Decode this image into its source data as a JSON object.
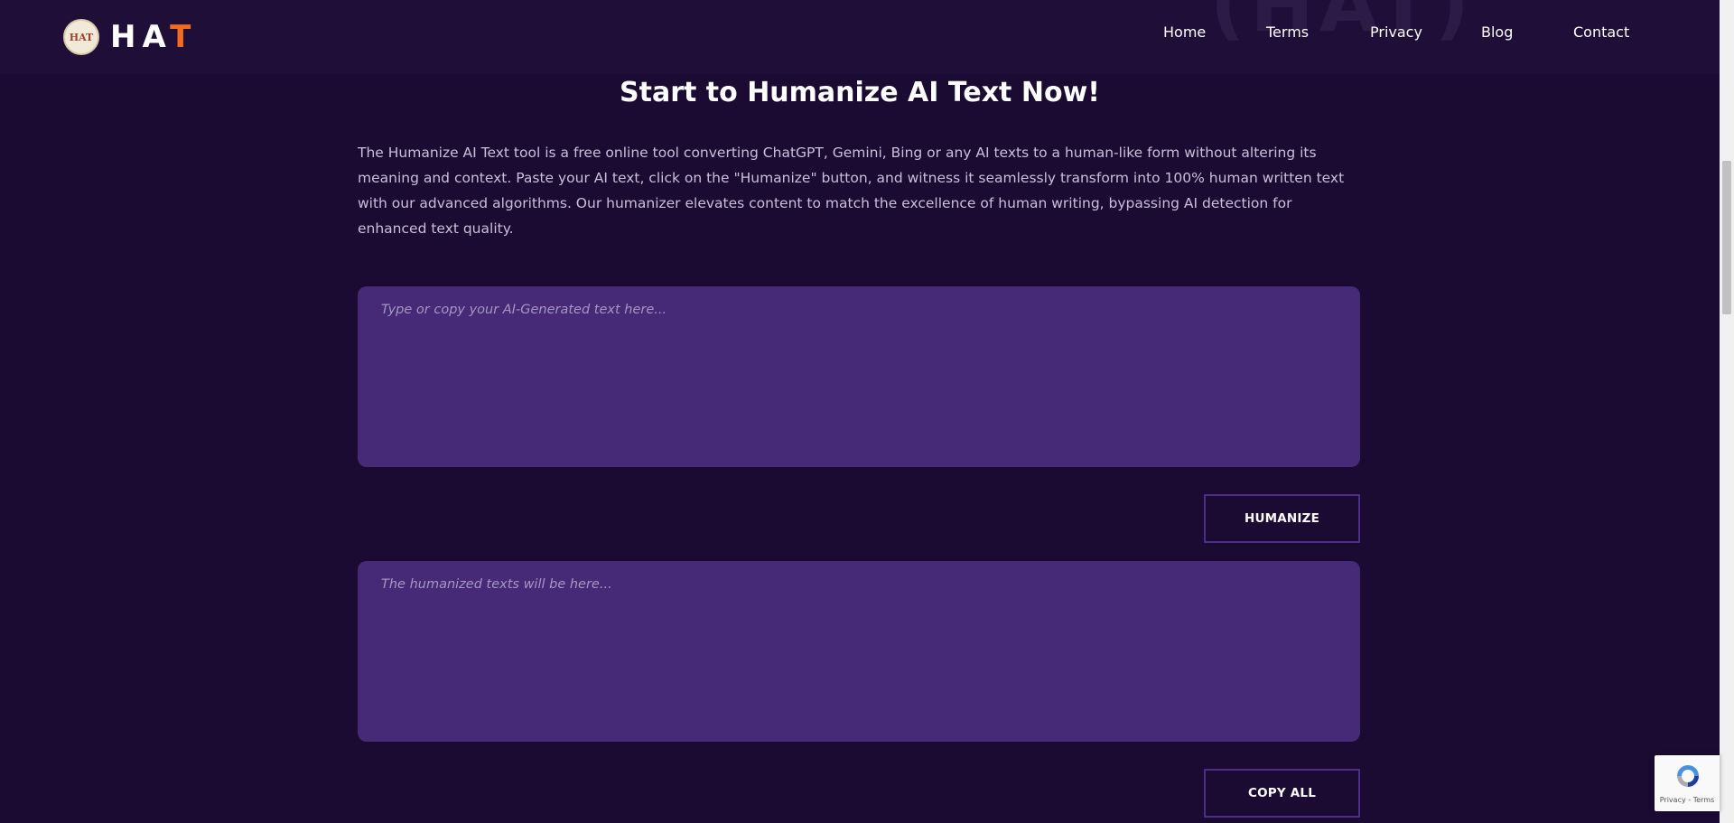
{
  "header": {
    "logo_badge_text": "HAT",
    "logo_text_main": "HA",
    "logo_text_accent": "T",
    "watermark": "(HAT)",
    "nav": [
      {
        "label": "Home"
      },
      {
        "label": "Terms"
      },
      {
        "label": "Privacy"
      },
      {
        "label": "Blog"
      },
      {
        "label": "Contact"
      }
    ]
  },
  "main": {
    "title": "Start to Humanize AI Text Now!",
    "description": "The Humanize AI Text tool is a free online tool converting ChatGPT, Gemini, Bing or any AI texts to a human-like form without altering its meaning and context. Paste your AI text, click on the \"Humanize\" button, and witness it seamlessly transform into 100% human written text with our advanced algorithms. Our humanizer elevates content to match the excellence of human writing, bypassing AI detection for enhanced text quality.",
    "input": {
      "placeholder": "Type or copy your AI-Generated text here...",
      "value": ""
    },
    "humanize_label": "HUMANIZE",
    "output": {
      "placeholder": "The humanized texts will be here...",
      "value": ""
    },
    "copy_all_label": "COPY ALL"
  },
  "recaptcha": {
    "privacy": "Privacy",
    "separator": " - ",
    "terms": "Terms"
  },
  "colors": {
    "background": "#1b0b33",
    "header": "#1f0e38",
    "textbox": "#462a77",
    "accent": "#f36b20",
    "button_border": "#4e2d8a"
  }
}
